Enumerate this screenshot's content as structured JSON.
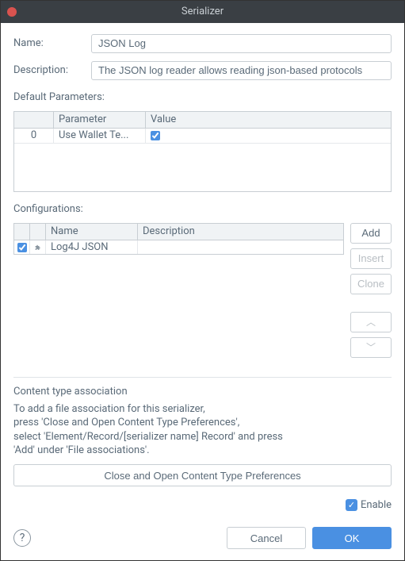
{
  "window": {
    "title": "Serializer"
  },
  "form": {
    "name_label": "Name:",
    "name_value": "JSON Log",
    "description_label": "Description:",
    "description_value": "The JSON log reader allows reading json-based protocols"
  },
  "default_params": {
    "section_label": "Default Parameters:",
    "columns": {
      "index": "",
      "parameter": "Parameter",
      "value": "Value"
    },
    "rows": [
      {
        "index": "0",
        "parameter": "Use Wallet Te...",
        "checked": true
      }
    ]
  },
  "configs": {
    "section_label": "Configurations:",
    "columns": {
      "check": "",
      "icon": "",
      "name": "Name",
      "description": "Description"
    },
    "rows": [
      {
        "checked": true,
        "name": "Log4J JSON",
        "description": ""
      }
    ],
    "buttons": {
      "add": "Add",
      "insert": "Insert",
      "clone": "Clone",
      "up": "▲",
      "down": "▼"
    }
  },
  "content_assoc": {
    "title": "Content type association",
    "text": "To add a file association for this serializer,\npress 'Close and Open Content Type Preferences',\nselect 'Element/Record/[serializer name] Record' and press\n'Add' under 'File associations'.",
    "button": "Close and Open Content Type Preferences"
  },
  "enable": {
    "label": "Enable",
    "checked": true
  },
  "footer": {
    "cancel": "Cancel",
    "ok": "OK"
  }
}
